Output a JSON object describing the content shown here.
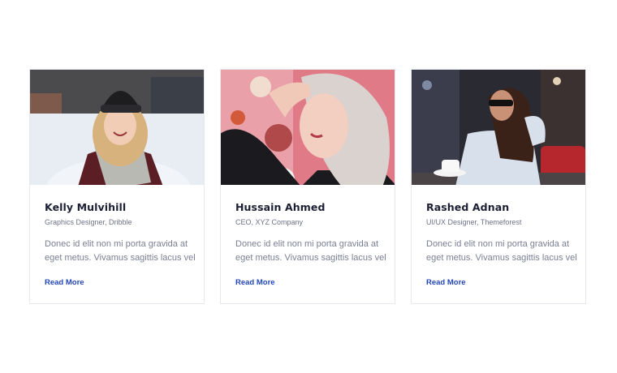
{
  "team": {
    "members": [
      {
        "name": "Kelly Mulvihill",
        "role": "Graphics Designer, Dribble",
        "description": "Donec id elit non mi porta gravida at eget metus. Vivamus sagittis lacus vel",
        "link_label": "Read More"
      },
      {
        "name": "Hussain Ahmed",
        "role": "CEO, XYZ Company",
        "description": "Donec id elit non mi porta gravida at eget metus. Vivamus sagittis lacus vel",
        "link_label": "Read More"
      },
      {
        "name": "Rashed Adnan",
        "role": "UI/UX Designer, Themeforest",
        "description": "Donec id elit non mi porta gravida at eget metus. Vivamus sagittis lacus vel",
        "link_label": "Read More"
      }
    ]
  },
  "colors": {
    "name_text": "#1c1f33",
    "role_text": "#6d7287",
    "body_text": "#7a7f93",
    "link": "#2346b8",
    "card_border": "#e6e8ee"
  }
}
